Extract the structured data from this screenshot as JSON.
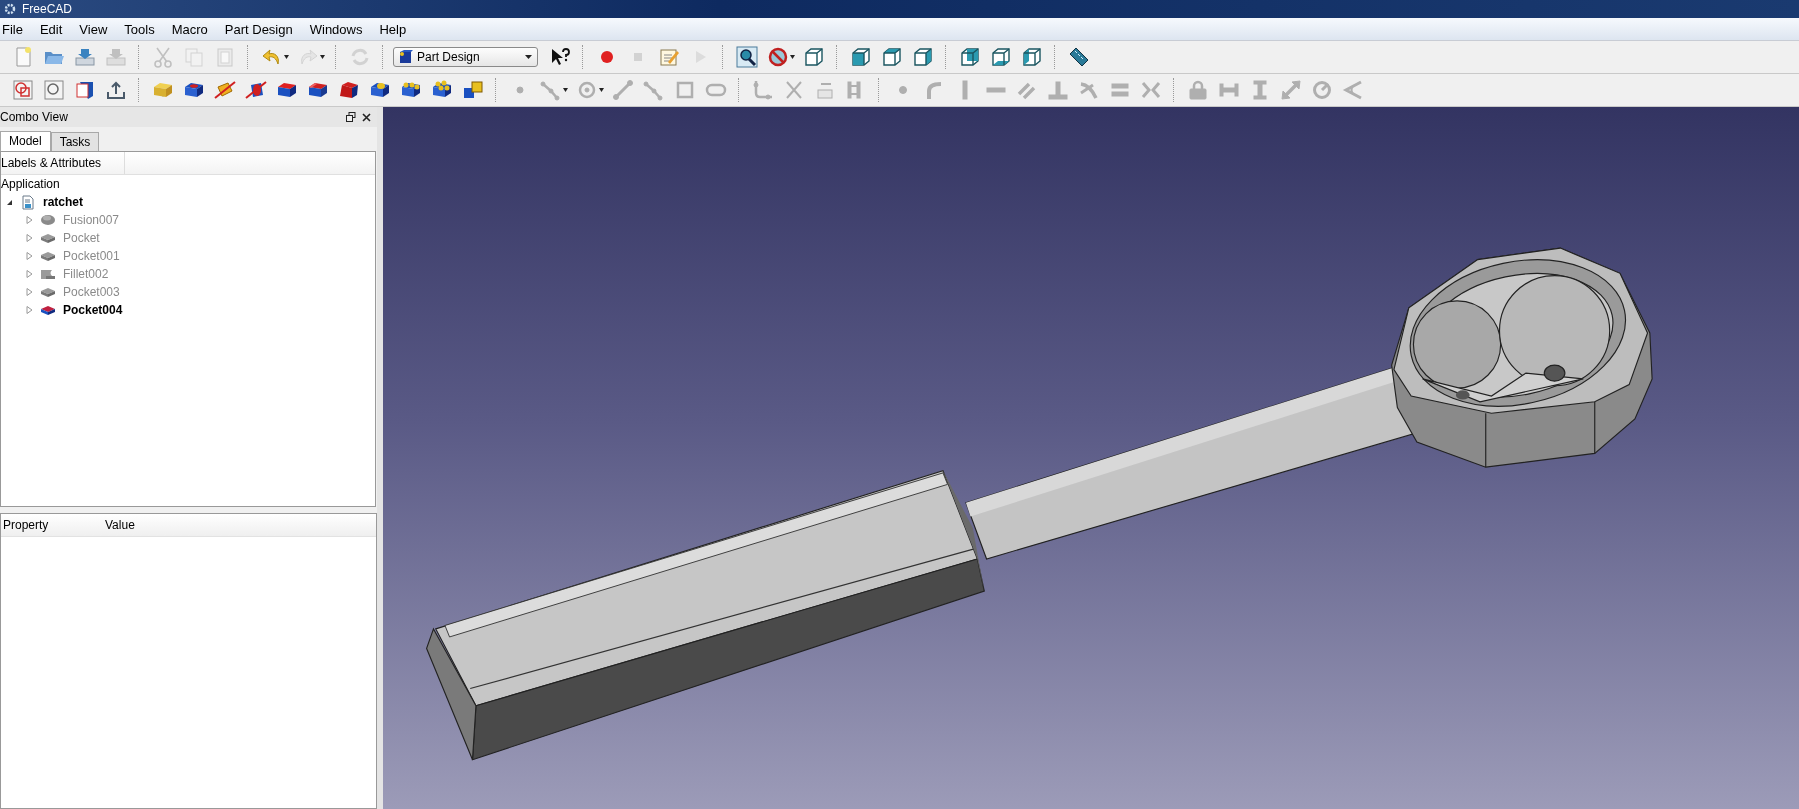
{
  "window": {
    "title": "FreeCAD"
  },
  "menu": [
    "File",
    "Edit",
    "View",
    "Tools",
    "Macro",
    "Part Design",
    "Windows",
    "Help"
  ],
  "toolbars": [
    {
      "items": [
        {
          "kind": "new",
          "disabled": false
        },
        {
          "kind": "open",
          "disabled": false
        },
        {
          "kind": "save",
          "disabled": false
        },
        {
          "kind": "save-as",
          "disabled": true
        },
        {
          "kind": "separator"
        },
        {
          "kind": "cut",
          "disabled": true
        },
        {
          "kind": "copy",
          "disabled": true
        },
        {
          "kind": "paste",
          "disabled": true
        },
        {
          "kind": "separator"
        },
        {
          "kind": "undo",
          "disabled": false
        },
        {
          "kind": "dropdown"
        },
        {
          "kind": "redo",
          "disabled": true
        },
        {
          "kind": "dropdown"
        },
        {
          "kind": "separator"
        },
        {
          "kind": "refresh",
          "disabled": true
        },
        {
          "kind": "separator"
        },
        {
          "kind": "combo",
          "value": "Part Design"
        },
        {
          "kind": "whatsthis",
          "disabled": false
        },
        {
          "kind": "separator"
        },
        {
          "kind": "record",
          "disabled": false
        },
        {
          "kind": "stop",
          "disabled": true
        },
        {
          "kind": "macro-edit",
          "disabled": false
        },
        {
          "kind": "play",
          "disabled": true
        },
        {
          "kind": "separator"
        },
        {
          "kind": "fit",
          "disabled": false
        },
        {
          "kind": "drawstyle",
          "disabled": false
        },
        {
          "kind": "dropdown"
        },
        {
          "kind": "view-iso",
          "disabled": false
        },
        {
          "kind": "separator"
        },
        {
          "kind": "view-front",
          "disabled": false
        },
        {
          "kind": "view-top",
          "disabled": false
        },
        {
          "kind": "view-right",
          "disabled": false
        },
        {
          "kind": "separator"
        },
        {
          "kind": "view-rear",
          "disabled": false
        },
        {
          "kind": "view-bottom",
          "disabled": false
        },
        {
          "kind": "view-left",
          "disabled": false
        },
        {
          "kind": "separator"
        },
        {
          "kind": "measure",
          "disabled": false
        }
      ]
    },
    {
      "items": [
        {
          "kind": "sketch-new",
          "disabled": false
        },
        {
          "kind": "sketch-view",
          "disabled": false
        },
        {
          "kind": "sketch-map",
          "disabled": false
        },
        {
          "kind": "sketch-leave",
          "disabled": false
        },
        {
          "kind": "separator"
        },
        {
          "kind": "pad",
          "disabled": false
        },
        {
          "kind": "pocket",
          "disabled": false
        },
        {
          "kind": "revolve",
          "disabled": false
        },
        {
          "kind": "groove",
          "disabled": false
        },
        {
          "kind": "fillet",
          "disabled": false
        },
        {
          "kind": "chamfer",
          "disabled": false
        },
        {
          "kind": "draft",
          "disabled": false
        },
        {
          "kind": "mirror",
          "disabled": false
        },
        {
          "kind": "linear-pattern",
          "disabled": false
        },
        {
          "kind": "polar-pattern",
          "disabled": false
        },
        {
          "kind": "multi-transform",
          "disabled": false
        },
        {
          "kind": "separator"
        },
        {
          "kind": "point",
          "disabled": true
        },
        {
          "kind": "polyline",
          "disabled": true
        },
        {
          "kind": "dropdown"
        },
        {
          "kind": "circle",
          "disabled": true
        },
        {
          "kind": "dropdown"
        },
        {
          "kind": "line",
          "disabled": true
        },
        {
          "kind": "polyline",
          "disabled": true
        },
        {
          "kind": "rectangle",
          "disabled": true
        },
        {
          "kind": "slot",
          "disabled": true
        },
        {
          "kind": "separator"
        },
        {
          "kind": "sketch-fillet",
          "disabled": true
        },
        {
          "kind": "trim",
          "disabled": true
        },
        {
          "kind": "external",
          "disabled": true
        },
        {
          "kind": "construction",
          "disabled": true
        },
        {
          "kind": "separator"
        },
        {
          "kind": "c-point",
          "disabled": true
        },
        {
          "kind": "c-tangent-arc",
          "disabled": true
        },
        {
          "kind": "c-vertical",
          "disabled": true
        },
        {
          "kind": "c-horizontal",
          "disabled": true
        },
        {
          "kind": "c-parallel",
          "disabled": true
        },
        {
          "kind": "c-perpendicular",
          "disabled": true
        },
        {
          "kind": "c-tangent",
          "disabled": true
        },
        {
          "kind": "c-equal",
          "disabled": true
        },
        {
          "kind": "c-symmetric",
          "disabled": true
        },
        {
          "kind": "separator"
        },
        {
          "kind": "c-lock",
          "disabled": true
        },
        {
          "kind": "c-hdist",
          "disabled": true
        },
        {
          "kind": "c-vdist",
          "disabled": true
        },
        {
          "kind": "c-distance",
          "disabled": true
        },
        {
          "kind": "c-radius",
          "disabled": true
        },
        {
          "kind": "c-angle",
          "disabled": true
        }
      ]
    }
  ],
  "combo_view": {
    "title": "Combo View",
    "tabs": [
      {
        "label": "Model",
        "selected": true
      },
      {
        "label": "Tasks",
        "selected": false
      }
    ],
    "tree": {
      "header": "Labels & Attributes",
      "root": "Application",
      "documents": [
        {
          "label": "ratchet",
          "expanded": true,
          "children": [
            {
              "label": "Fusion007",
              "kind": "fusion",
              "visible": false
            },
            {
              "label": "Pocket",
              "kind": "pocket",
              "visible": false
            },
            {
              "label": "Pocket001",
              "kind": "pocket",
              "visible": false
            },
            {
              "label": "Fillet002",
              "kind": "fillet",
              "visible": false
            },
            {
              "label": "Pocket003",
              "kind": "pocket",
              "visible": false
            },
            {
              "label": "Pocket004",
              "kind": "pocket",
              "visible": true
            }
          ]
        }
      ]
    },
    "properties": {
      "columns": [
        "Property",
        "Value"
      ]
    }
  }
}
